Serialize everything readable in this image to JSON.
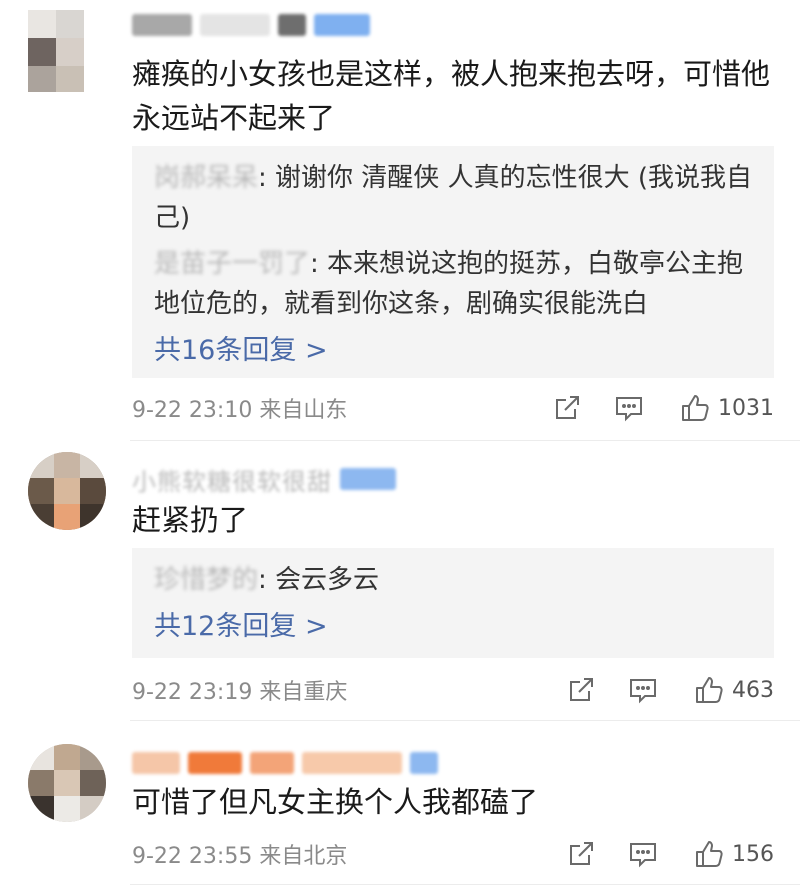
{
  "comments": [
    {
      "text": "瘫痪的小女孩也是这样，被人抱来抱去呀，可惜他永远站不起来了",
      "replies": [
        {
          "author": "岗郝呆呆",
          "text": ": 谢谢你 清醒侠 人真的忘性很大 (我说我自己)"
        },
        {
          "author": "是苗子一罚了",
          "text": ": 本来想说这抱的挺苏，白敬亭公主抱地位危的，就看到你这条，剧确实很能洗白"
        }
      ],
      "more_replies": "共16条回复 >",
      "time": "9-22 23:10 来自山东",
      "likes": "1031"
    },
    {
      "name": "小熊软糖很软很甜",
      "text": "赶紧扔了",
      "replies": [
        {
          "author": "珍惜梦的",
          "text": ": 会云多云"
        }
      ],
      "more_replies": "共12条回复 >",
      "time": "9-22 23:19 来自重庆",
      "likes": "463"
    },
    {
      "text": "可惜了但凡女主换个人我都磕了",
      "time": "9-22 23:55 来自北京",
      "likes": "156"
    }
  ],
  "icons": {
    "share": "share-icon",
    "comment": "comment-icon",
    "like": "thumbs-up-icon"
  },
  "colors": {
    "link": "#4a6aa8",
    "reply_bg": "#f4f4f4",
    "meta": "#8a8a8a"
  }
}
